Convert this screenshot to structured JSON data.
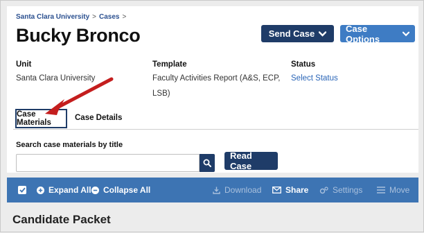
{
  "breadcrumb": [
    "Santa Clara University",
    "Cases"
  ],
  "breadcrumb_sep": ">",
  "page_title": "Bucky Bronco",
  "header_buttons": {
    "send_case": "Send Case",
    "case_options": "Case Options"
  },
  "info": {
    "unit_label": "Unit",
    "unit_value": "Santa Clara University",
    "template_label": "Template",
    "template_value_line1": "Faculty Activities Report (A&S, ECP,",
    "template_value_line2": "LSB)",
    "status_label": "Status",
    "status_value": "Select Status"
  },
  "tabs": [
    {
      "label": "Case Materials",
      "active": true
    },
    {
      "label": "Case Details",
      "active": false
    }
  ],
  "search": {
    "label": "Search case materials by title",
    "value": "",
    "placeholder": ""
  },
  "read_case_label": "Read Case",
  "toolbar": {
    "expand_all": "Expand All",
    "collapse_all": "Collapse All",
    "download": "Download",
    "share": "Share",
    "settings": "Settings",
    "move": "Move"
  },
  "section_title": "Candidate Packet",
  "colors": {
    "primary_dark": "#1f3c68",
    "primary": "#3e7cc4",
    "toolbar": "#3d74b3",
    "annotation_arrow": "#c41e1e"
  },
  "icons": [
    "chevron-down-icon",
    "search-icon",
    "check-icon",
    "plus-circle-icon",
    "minus-circle-icon",
    "download-icon",
    "envelope-icon",
    "gears-icon",
    "bars-icon",
    "arrow-annotation"
  ]
}
